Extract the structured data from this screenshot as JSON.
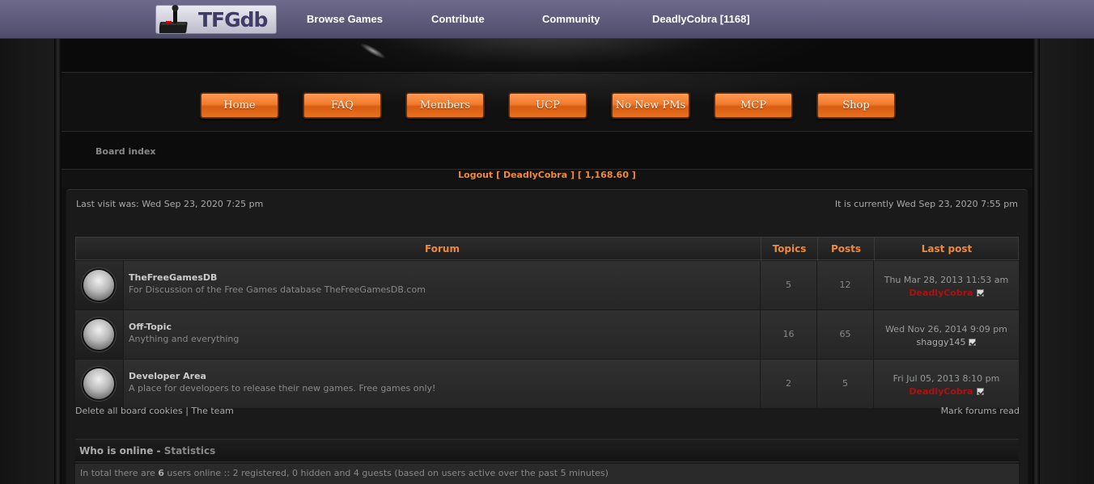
{
  "topnav": {
    "logo_text": "TFGdb",
    "links": [
      "Browse Games",
      "Contribute",
      "Community",
      "DeadlyCobra [1168]"
    ]
  },
  "buttons": [
    "Home",
    "FAQ",
    "Members",
    "UCP",
    "No New PMs",
    "MCP",
    "Shop"
  ],
  "breadcrumb": "Board index",
  "logout": {
    "prefix": "Logout [ ",
    "user": "DeadlyCobra",
    "mid": " ] [ ",
    "points": "1,168.60",
    "suffix": " ]"
  },
  "last_visit": "Last visit was: Wed Sep 23, 2020 7:25 pm",
  "current_time": "It is currently Wed Sep 23, 2020 7:55 pm",
  "table": {
    "headers": {
      "forum": "Forum",
      "topics": "Topics",
      "posts": "Posts",
      "last_post": "Last post"
    },
    "rows": [
      {
        "title": "TheFreeGamesDB",
        "desc": "For Discussion of the Free Games database TheFreeGamesDB.com",
        "topics": "5",
        "posts": "12",
        "last_date": "Thu Mar 28, 2013 11:53 am",
        "last_user": "DeadlyCobra"
      },
      {
        "title": "Off-Topic",
        "desc": "Anything and everything",
        "topics": "16",
        "posts": "65",
        "last_date": "Wed Nov 26, 2014 9:09 pm",
        "last_user": "shaggy145"
      },
      {
        "title": "Developer Area",
        "desc": "A place for developers to release their new games. Free games only!",
        "topics": "2",
        "posts": "5",
        "last_date": "Fri Jul 05, 2013 8:10 pm",
        "last_user": "DeadlyCobra"
      }
    ]
  },
  "footer": {
    "delete_cookies": "Delete all board cookies",
    "separator": "|",
    "team": "The team",
    "mark_read": "Mark forums read"
  },
  "online": {
    "title": "Who is online",
    "dash": " - ",
    "stats": "Statistics",
    "text_pre": "In total there are ",
    "count": "6",
    "text_post": " users online :: 2 registered, 0 hidden and 4 guests (based on users active over the past 5 minutes)"
  },
  "colors": {
    "accent": "#f0893a",
    "nav_bg": "#5e5b7c",
    "admin_user": "#b01010"
  }
}
